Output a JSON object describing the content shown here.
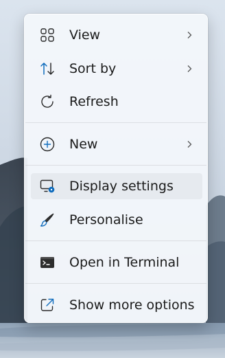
{
  "menu": {
    "items": [
      {
        "label": "View",
        "icon": "grid-view-icon",
        "submenu": true
      },
      {
        "label": "Sort by",
        "icon": "sort-arrows-icon",
        "submenu": true
      },
      {
        "label": "Refresh",
        "icon": "refresh-icon",
        "submenu": false
      },
      {
        "label": "New",
        "icon": "plus-circle-icon",
        "submenu": true
      },
      {
        "label": "Display settings",
        "icon": "display-settings-icon",
        "submenu": false,
        "highlighted": true
      },
      {
        "label": "Personalise",
        "icon": "paintbrush-icon",
        "submenu": false
      },
      {
        "label": "Open in Terminal",
        "icon": "terminal-icon",
        "submenu": false
      },
      {
        "label": "Show more options",
        "icon": "open-external-icon",
        "submenu": false
      }
    ]
  },
  "colors": {
    "accent": "#0f6cbd",
    "menu_background": "#f3f6fb",
    "text": "#1a1a1a"
  }
}
